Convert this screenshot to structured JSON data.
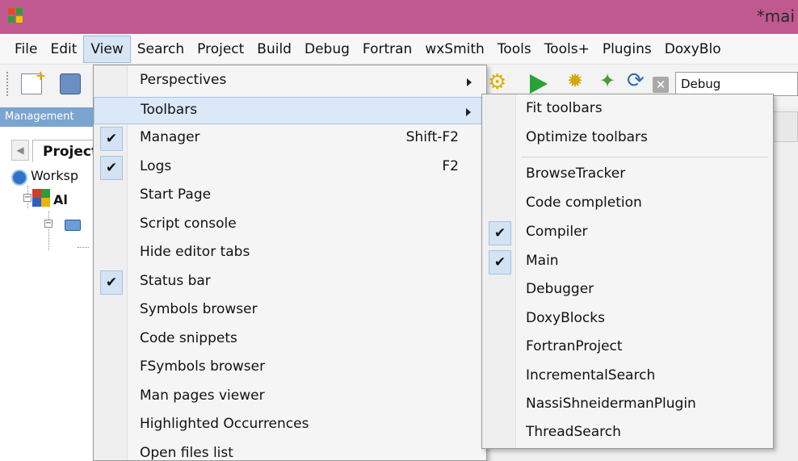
{
  "window": {
    "title": "*mai"
  },
  "menubar": {
    "items": [
      "File",
      "Edit",
      "View",
      "Search",
      "Project",
      "Build",
      "Debug",
      "Fortran",
      "wxSmith",
      "Tools",
      "Tools+",
      "Plugins",
      "DoxyBlo"
    ],
    "active": "View"
  },
  "toolbar": {
    "build_target": "Debug"
  },
  "management": {
    "header": "Management",
    "tab_label": "Projects",
    "workspace_label": "Worksp",
    "project_label": "Al"
  },
  "view_menu": {
    "items": [
      {
        "label": "Perspectives",
        "shortcut": "",
        "checked": false,
        "submenu": true
      },
      {
        "label": "Toolbars",
        "shortcut": "",
        "checked": false,
        "submenu": true,
        "highlighted": true
      },
      {
        "label": "Manager",
        "shortcut": "Shift-F2",
        "checked": true,
        "submenu": false
      },
      {
        "label": "Logs",
        "shortcut": "F2",
        "checked": true,
        "submenu": false
      },
      {
        "label": "Start Page",
        "shortcut": "",
        "checked": false,
        "submenu": false
      },
      {
        "label": "Script console",
        "shortcut": "",
        "checked": false,
        "submenu": false
      },
      {
        "label": "Hide editor tabs",
        "shortcut": "",
        "checked": false,
        "submenu": false
      },
      {
        "label": "Status bar",
        "shortcut": "",
        "checked": true,
        "submenu": false
      },
      {
        "label": "Symbols browser",
        "shortcut": "",
        "checked": false,
        "submenu": false
      },
      {
        "label": "Code snippets",
        "shortcut": "",
        "checked": false,
        "submenu": false
      },
      {
        "label": "FSymbols browser",
        "shortcut": "",
        "checked": false,
        "submenu": false
      },
      {
        "label": "Man pages viewer",
        "shortcut": "",
        "checked": false,
        "submenu": false
      },
      {
        "label": "Highlighted Occurrences",
        "shortcut": "",
        "checked": false,
        "submenu": false
      },
      {
        "label": "Open files list",
        "shortcut": "",
        "checked": false,
        "submenu": false
      }
    ]
  },
  "toolbars_submenu": {
    "items": [
      {
        "label": "Fit toolbars",
        "checked": false
      },
      {
        "label": "Optimize toolbars",
        "checked": false
      },
      {
        "label": "BrowseTracker",
        "checked": false
      },
      {
        "label": "Code completion",
        "checked": false
      },
      {
        "label": "Compiler",
        "checked": true
      },
      {
        "label": "Main",
        "checked": true
      },
      {
        "label": "Debugger",
        "checked": false
      },
      {
        "label": "DoxyBlocks",
        "checked": false
      },
      {
        "label": "FortranProject",
        "checked": false
      },
      {
        "label": "IncrementalSearch",
        "checked": false
      },
      {
        "label": "NassiShneidermanPlugin",
        "checked": false
      },
      {
        "label": "ThreadSearch",
        "checked": false
      }
    ]
  },
  "check_glyph": "✔",
  "colors": {
    "titlebar": "#c0598f",
    "menu_highlight": "#dae8f7",
    "check_bg": "#d3e3f4",
    "panel_header": "#7ba4d0"
  }
}
